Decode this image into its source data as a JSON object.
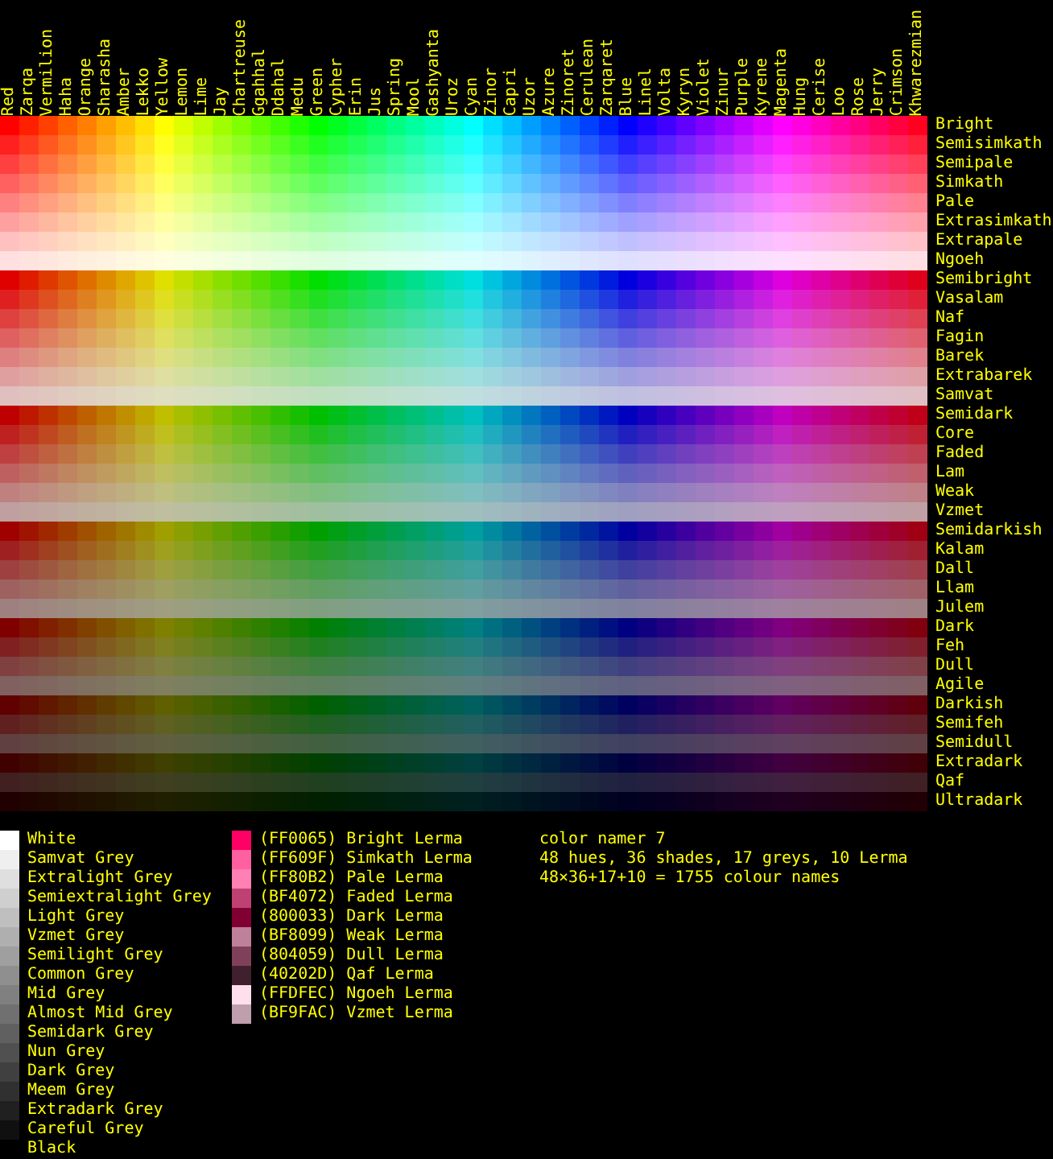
{
  "hues": [
    {
      "name": "Red",
      "color": "#ff0000"
    },
    {
      "name": "Zarqa",
      "color": "#ff2000"
    },
    {
      "name": "Vermilion",
      "color": "#ff4000"
    },
    {
      "name": "Haha",
      "color": "#ff6000"
    },
    {
      "name": "Orange",
      "color": "#ff8000"
    },
    {
      "name": "Sharasha",
      "color": "#ff9f00"
    },
    {
      "name": "Amber",
      "color": "#ffbf00"
    },
    {
      "name": "Lekko",
      "color": "#ffdf00"
    },
    {
      "name": "Yellow",
      "color": "#ffff00"
    },
    {
      "name": "Lemon",
      "color": "#dfff00"
    },
    {
      "name": "Lime",
      "color": "#bfff00"
    },
    {
      "name": "Jay",
      "color": "#9fff00"
    },
    {
      "name": "Chartreuse",
      "color": "#80ff00"
    },
    {
      "name": "Ggahhal",
      "color": "#60ff00"
    },
    {
      "name": "Ddahal",
      "color": "#40ff00"
    },
    {
      "name": "Medu",
      "color": "#20ff00"
    },
    {
      "name": "Green",
      "color": "#00ff00"
    },
    {
      "name": "Cypher",
      "color": "#00ff20"
    },
    {
      "name": "Erin",
      "color": "#00ff40"
    },
    {
      "name": "Jus",
      "color": "#00ff60"
    },
    {
      "name": "Spring",
      "color": "#00ff80"
    },
    {
      "name": "Mool",
      "color": "#00ff9f"
    },
    {
      "name": "Gashyanta",
      "color": "#00ffbf"
    },
    {
      "name": "Uroz",
      "color": "#00ffdf"
    },
    {
      "name": "Cyan",
      "color": "#00ffff"
    },
    {
      "name": "Zinor",
      "color": "#00dfff"
    },
    {
      "name": "Capri",
      "color": "#00bfff"
    },
    {
      "name": "Uzor",
      "color": "#009fff"
    },
    {
      "name": "Azure",
      "color": "#0080ff"
    },
    {
      "name": "Zinoret",
      "color": "#0060ff"
    },
    {
      "name": "Cerulean",
      "color": "#0040ff"
    },
    {
      "name": "Zarqaret",
      "color": "#0020ff"
    },
    {
      "name": "Blue",
      "color": "#0000ff"
    },
    {
      "name": "Linel",
      "color": "#2000ff"
    },
    {
      "name": "Volta",
      "color": "#4000ff"
    },
    {
      "name": "Kyryn",
      "color": "#6000ff"
    },
    {
      "name": "Violet",
      "color": "#8000ff"
    },
    {
      "name": "Zinur",
      "color": "#9f00ff"
    },
    {
      "name": "Purple",
      "color": "#bf00ff"
    },
    {
      "name": "Kyrene",
      "color": "#df00ff"
    },
    {
      "name": "Magenta",
      "color": "#ff00ff"
    },
    {
      "name": "Hung",
      "color": "#ff00df"
    },
    {
      "name": "Cerise",
      "color": "#ff00bf"
    },
    {
      "name": "Loo",
      "color": "#ff009f"
    },
    {
      "name": "Rose",
      "color": "#ff0080"
    },
    {
      "name": "Jerry",
      "color": "#ff0060"
    },
    {
      "name": "Crimson",
      "color": "#ff0040"
    },
    {
      "name": "Khwarezmian",
      "color": "#ff0020"
    }
  ],
  "shades": [
    {
      "name": "Bright",
      "color": "#ff0000"
    },
    {
      "name": "Semisimkath",
      "color": "#ff2020"
    },
    {
      "name": "Semipale",
      "color": "#ff4040"
    },
    {
      "name": "Simkath",
      "color": "#ff6060"
    },
    {
      "name": "Pale",
      "color": "#ff8080"
    },
    {
      "name": "Extrasimkath",
      "color": "#ffa0a0"
    },
    {
      "name": "Extrapale",
      "color": "#ffc0c0"
    },
    {
      "name": "Ngoeh",
      "color": "#ffdfdf"
    },
    {
      "name": "Semibright",
      "color": "#df0000"
    },
    {
      "name": "Vasalam",
      "color": "#df2020"
    },
    {
      "name": "Naf",
      "color": "#df4040"
    },
    {
      "name": "Fagin",
      "color": "#df6060"
    },
    {
      "name": "Barek",
      "color": "#df8080"
    },
    {
      "name": "Extrabarek",
      "color": "#df9f9f"
    },
    {
      "name": "Samvat",
      "color": "#dfbfbf"
    },
    {
      "name": "Semidark",
      "color": "#bf0000"
    },
    {
      "name": "Core",
      "color": "#bf2020"
    },
    {
      "name": "Faded",
      "color": "#bf4040"
    },
    {
      "name": "Lam",
      "color": "#bf6060"
    },
    {
      "name": "Weak",
      "color": "#bf8080"
    },
    {
      "name": "Vzmet",
      "color": "#bf9f9f"
    },
    {
      "name": "Semidarkish",
      "color": "#9f0000"
    },
    {
      "name": "Kalam",
      "color": "#9f2020"
    },
    {
      "name": "Dall",
      "color": "#9f4040"
    },
    {
      "name": "Llam",
      "color": "#9f6060"
    },
    {
      "name": "Julem",
      "color": "#9f8080"
    },
    {
      "name": "Dark",
      "color": "#800000"
    },
    {
      "name": "Feh",
      "color": "#802020"
    },
    {
      "name": "Dull",
      "color": "#804040"
    },
    {
      "name": "Agile",
      "color": "#806060"
    },
    {
      "name": "Darkish",
      "color": "#600000"
    },
    {
      "name": "Semifeh",
      "color": "#602020"
    },
    {
      "name": "Semidull",
      "color": "#604040"
    },
    {
      "name": "Extradark",
      "color": "#400000"
    },
    {
      "name": "Qaf",
      "color": "#402020"
    },
    {
      "name": "Ultradark",
      "color": "#200000"
    }
  ],
  "greys": [
    {
      "name": "White",
      "color": "#ffffff"
    },
    {
      "name": "Samvat Grey",
      "color": "#efefef"
    },
    {
      "name": "Extralight Grey",
      "color": "#dfdfdf"
    },
    {
      "name": "Semiextralight Grey",
      "color": "#cfcfcf"
    },
    {
      "name": "Light Grey",
      "color": "#bfbfbf"
    },
    {
      "name": "Vzmet Grey",
      "color": "#afafaf"
    },
    {
      "name": "Semilight Grey",
      "color": "#9f9f9f"
    },
    {
      "name": "Common Grey",
      "color": "#8f8f8f"
    },
    {
      "name": "Mid Grey",
      "color": "#808080"
    },
    {
      "name": "Almost Mid Grey",
      "color": "#707070"
    },
    {
      "name": "Semidark Grey",
      "color": "#606060"
    },
    {
      "name": "Nun Grey",
      "color": "#505050"
    },
    {
      "name": "Dark Grey",
      "color": "#404040"
    },
    {
      "name": "Meem Grey",
      "color": "#303030"
    },
    {
      "name": "Extradark Grey",
      "color": "#202020"
    },
    {
      "name": "Careful Grey",
      "color": "#101010"
    },
    {
      "name": "Black",
      "color": "#000000"
    }
  ],
  "lerma": [
    {
      "label": "(FF0065) Bright Lerma",
      "color": "#ff0065"
    },
    {
      "label": "(FF609F) Simkath Lerma",
      "color": "#ff609f"
    },
    {
      "label": "(FF80B2) Pale Lerma",
      "color": "#ff80b2"
    },
    {
      "label": "(BF4072) Faded Lerma",
      "color": "#bf4072"
    },
    {
      "label": "(800033) Dark Lerma",
      "color": "#800033"
    },
    {
      "label": "(BF8099) Weak Lerma",
      "color": "#bf8099"
    },
    {
      "label": "(804059) Dull Lerma",
      "color": "#804059"
    },
    {
      "label": "(40202D) Qaf Lerma",
      "color": "#40202d"
    },
    {
      "label": "(FFDFEC) Ngoeh Lerma",
      "color": "#ffdfec"
    },
    {
      "label": "(BF9FAC) Vzmet Lerma",
      "color": "#bf9fac"
    }
  ],
  "info": [
    "color namer 7",
    "48 hues, 36 shades, 17 greys, 10 Lerma",
    "48×36+17+10 = 1755 colour names"
  ]
}
